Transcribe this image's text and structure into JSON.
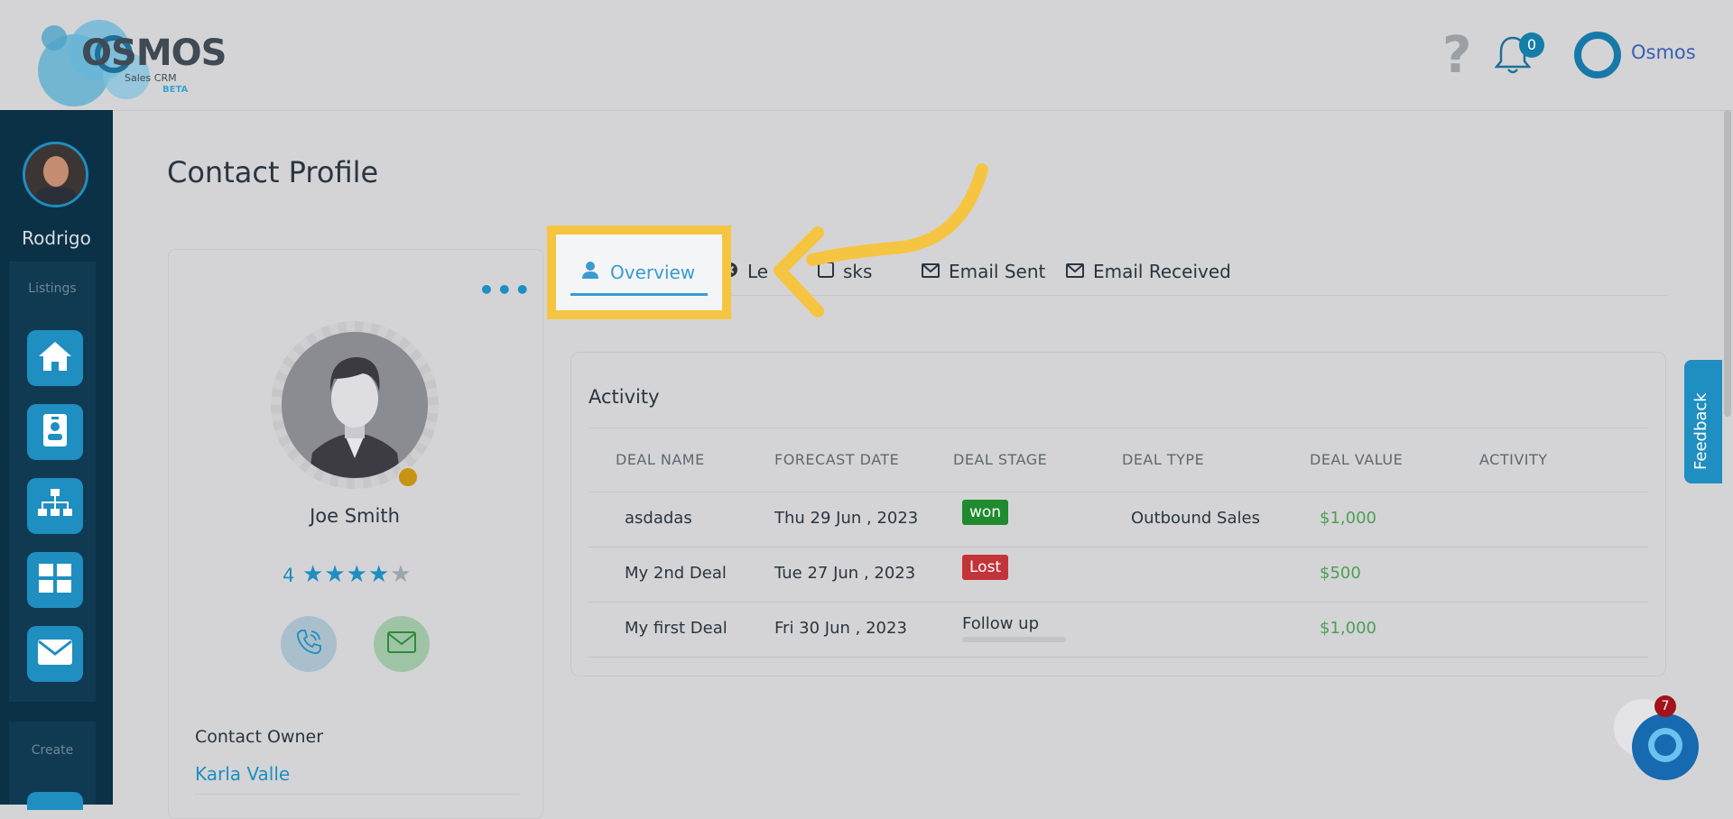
{
  "header": {
    "logo": {
      "brand": "OSMOS",
      "sub": "Sales CRM",
      "beta": "BETA"
    },
    "help_glyph": "?",
    "notifications_count": "0",
    "user_name": "Osmos"
  },
  "sidebar": {
    "user_name": "Rodrigo",
    "section_listings": "Listings",
    "section_create": "Create",
    "items": [
      {
        "icon": "home-icon"
      },
      {
        "icon": "contact-card-icon"
      },
      {
        "icon": "org-chart-icon"
      },
      {
        "icon": "grid-icon"
      },
      {
        "icon": "mail-icon"
      }
    ]
  },
  "page": {
    "title": "Contact Profile"
  },
  "profile": {
    "name": "Joe Smith",
    "rating": "4",
    "stars_filled": 4,
    "stars_total": 5,
    "contact_owner_label": "Contact Owner",
    "contact_owner_value": "Karla Valle",
    "more_glyph": "•••"
  },
  "tabs": [
    {
      "label": "Overview",
      "icon": "user-icon",
      "active": true
    },
    {
      "label": "Le",
      "icon": "x-circle-icon"
    },
    {
      "label": "sks",
      "icon": "tasks-icon"
    },
    {
      "label": "Email Sent",
      "icon": "envelope-icon"
    },
    {
      "label": "Email Received",
      "icon": "envelope-icon"
    }
  ],
  "activity": {
    "title": "Activity",
    "columns": [
      "DEAL NAME",
      "FORECAST DATE",
      "DEAL STAGE",
      "DEAL TYPE",
      "DEAL VALUE",
      "ACTIVITY"
    ],
    "rows": [
      {
        "name": "asdadas",
        "date": "Thu 29 Jun , 2023",
        "stage": "won",
        "stage_color": "#1f8a2e",
        "type": "Outbound Sales",
        "value": "$1,000"
      },
      {
        "name": "My 2nd Deal",
        "date": "Tue 27 Jun , 2023",
        "stage": "Lost",
        "stage_color": "#c2343a",
        "type": "",
        "value": "$500"
      },
      {
        "name": "My first Deal",
        "date": "Fri 30 Jun , 2023",
        "stage": "Follow up",
        "stage_color": "",
        "type": "",
        "value": "$1,000"
      }
    ]
  },
  "feedback_label": "Feedback",
  "chat": {
    "badge": "7"
  },
  "colors": {
    "accent": "#1f8ec1",
    "highlight": "#f5c542",
    "sidebar": "#0b3147",
    "success": "#4e9e55"
  }
}
